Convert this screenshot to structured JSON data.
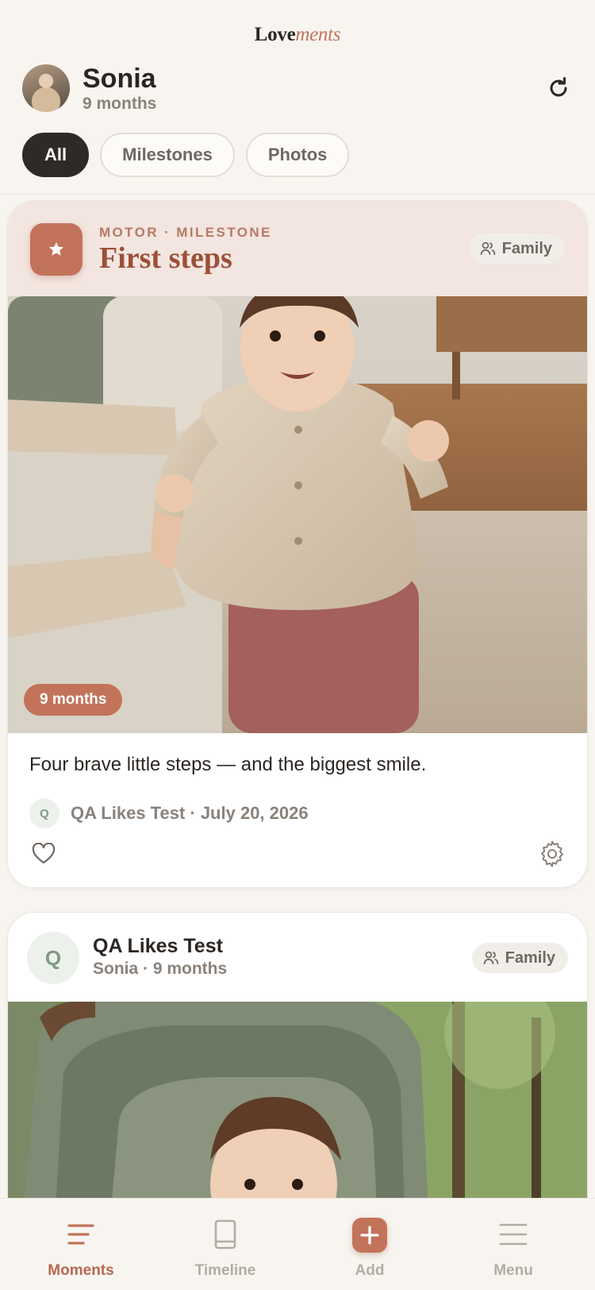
{
  "app": {
    "brand_main": "Love",
    "brand_accent": "ments"
  },
  "profile": {
    "name": "Sonia",
    "age": "9 months"
  },
  "filters": [
    {
      "label": "All",
      "active": true
    },
    {
      "label": "Milestones",
      "active": false
    },
    {
      "label": "Photos",
      "active": false
    }
  ],
  "feed": {
    "milestone_card": {
      "category": "MOTOR · MILESTONE",
      "title": "First steps",
      "audience": "Family",
      "age_badge": "9 months",
      "caption": "Four brave little steps — and the biggest smile.",
      "author_initial": "Q",
      "author_line": "QA Likes Test · July 20, 2026"
    },
    "post_card": {
      "author_initial": "Q",
      "author_name": "QA Likes Test",
      "subtitle": "Sonia · 9 months",
      "audience": "Family"
    }
  },
  "nav": {
    "items": [
      {
        "label": "Moments",
        "icon": "moments-icon",
        "active": true
      },
      {
        "label": "Timeline",
        "icon": "book-icon",
        "active": false
      },
      {
        "label": "Add",
        "icon": "plus-icon",
        "active": false
      },
      {
        "label": "Menu",
        "icon": "menu-icon",
        "active": false
      }
    ]
  },
  "colors": {
    "accent": "#c2735a",
    "accent_dark": "#9c4f39",
    "background": "#f8f5f1",
    "milestone_header": "#f3e5df"
  }
}
